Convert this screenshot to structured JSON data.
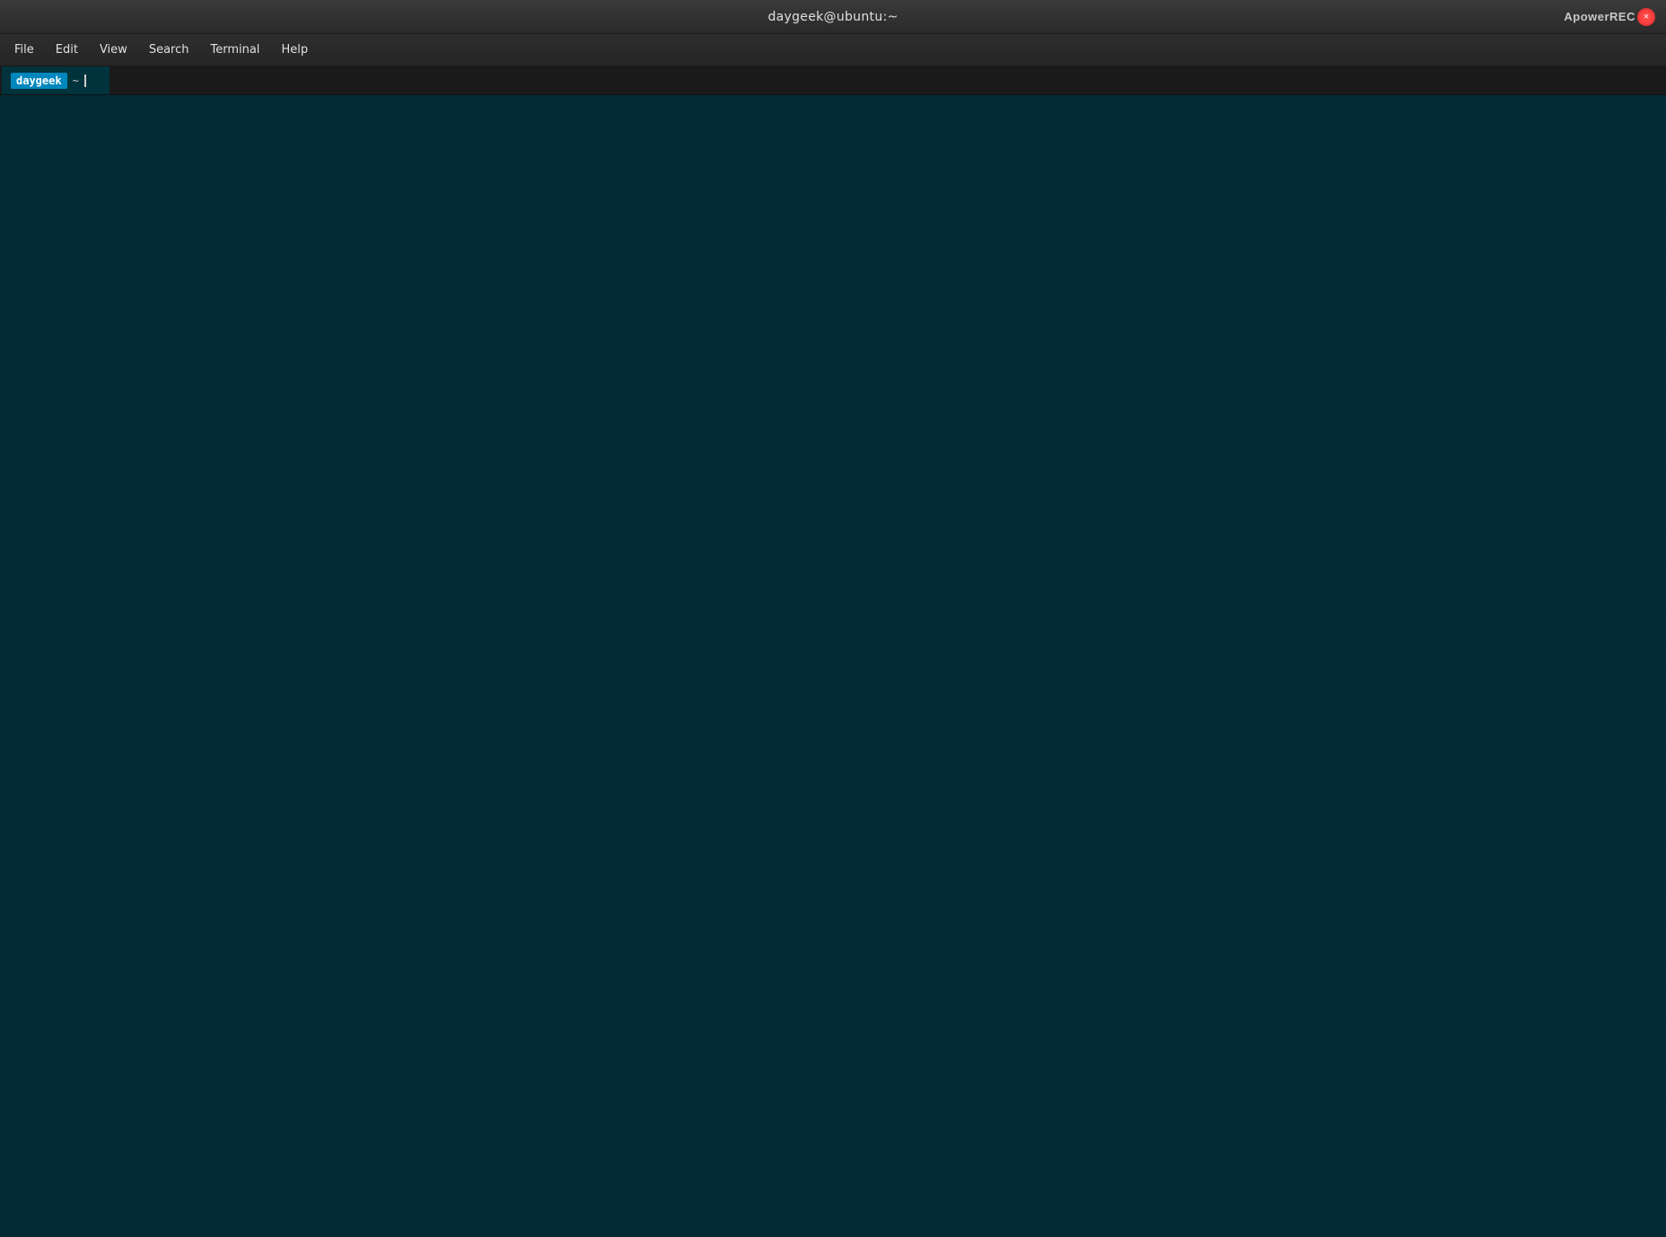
{
  "titlebar": {
    "title": "daygeek@ubuntu:~",
    "watermark": "ApowerREC",
    "watermark_icon": "●"
  },
  "menubar": {
    "items": [
      {
        "label": "File",
        "id": "file"
      },
      {
        "label": "Edit",
        "id": "edit"
      },
      {
        "label": "View",
        "id": "view"
      },
      {
        "label": "Search",
        "id": "search"
      },
      {
        "label": "Terminal",
        "id": "terminal"
      },
      {
        "label": "Help",
        "id": "help"
      }
    ]
  },
  "tabbar": {
    "active_tab": {
      "user": "daygeek",
      "path": "~",
      "cursor": "|"
    }
  },
  "terminal": {
    "background_color": "#012b36",
    "cursor_char": "|"
  },
  "colors": {
    "titlebar_bg": "#2e2e2e",
    "menubar_bg": "#252525",
    "tabbar_bg": "#1a1a1a",
    "terminal_bg": "#012b36",
    "tab_user_bg": "#0087bd",
    "text_color": "#e0e0e0",
    "tab_path_color": "#cccccc"
  }
}
